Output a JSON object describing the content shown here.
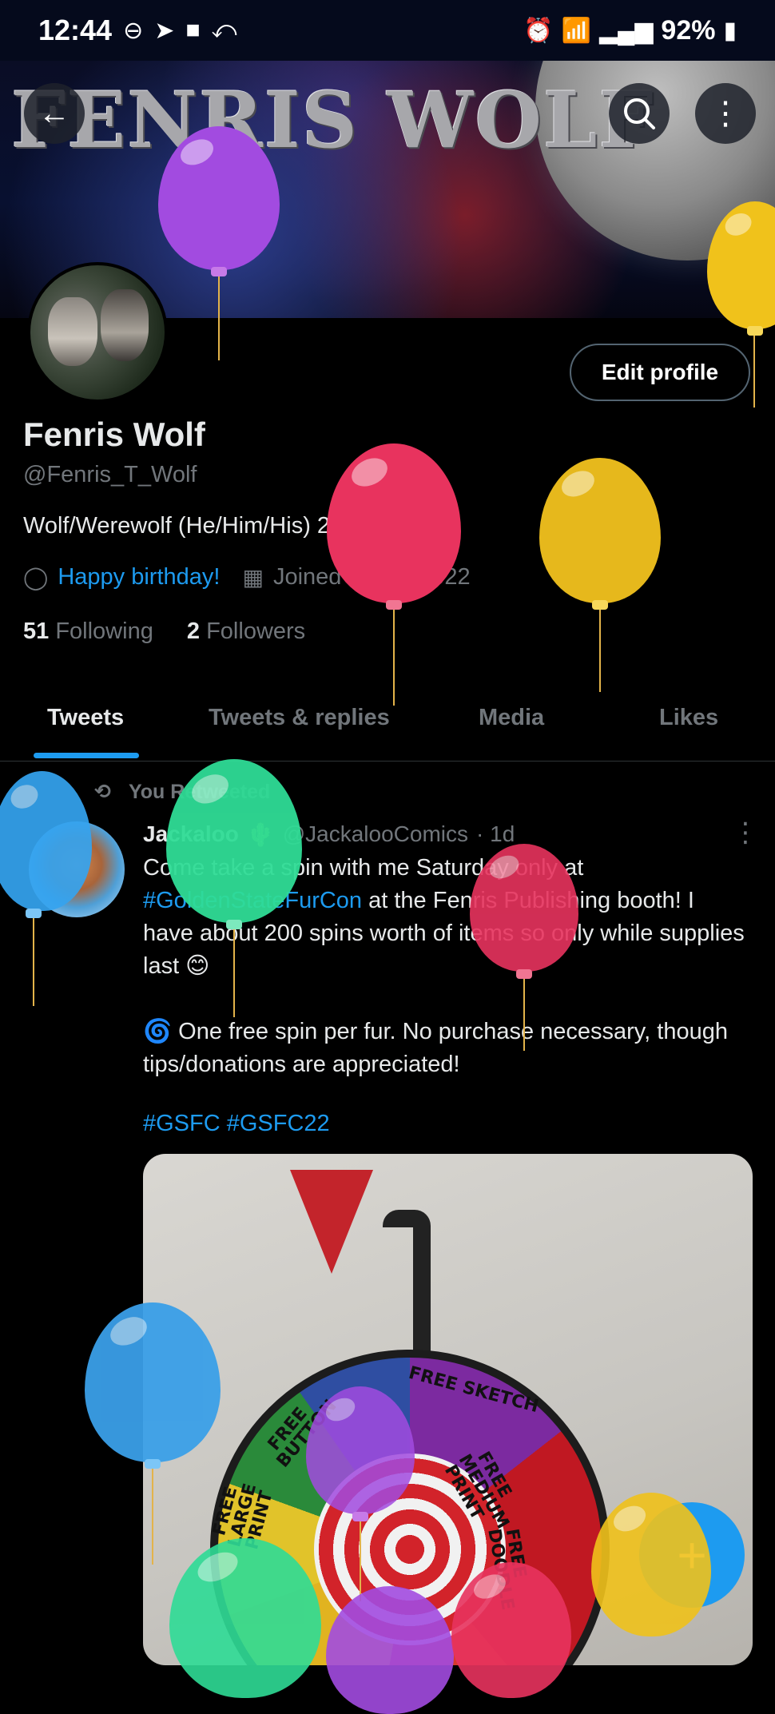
{
  "status_bar": {
    "time": "12:44",
    "left_icons": [
      "do-not-disturb-icon",
      "telegram-icon",
      "message-icon",
      "missed-call-icon"
    ],
    "right_icons": [
      "alarm-icon",
      "wifi-icon",
      "signal-icon"
    ],
    "battery": "92%"
  },
  "banner": {
    "title": "FENRIS WOLF"
  },
  "profile": {
    "edit_label": "Edit profile",
    "name": "Fenris Wolf",
    "handle": "@Fenris_T_Wolf",
    "bio": "Wolf/Werewolf (He/Him/His) 28",
    "birthday": "Happy birthday!",
    "joined": "Joined March 2022",
    "following_count": "51",
    "following_label": "Following",
    "followers_count": "2",
    "followers_label": "Followers"
  },
  "tabs": [
    {
      "label": "Tweets",
      "active": true
    },
    {
      "label": "Tweets & replies",
      "active": false
    },
    {
      "label": "Media",
      "active": false
    },
    {
      "label": "Likes",
      "active": false
    }
  ],
  "tweet": {
    "retweet_label": "You Retweeted",
    "author": "Jackaloo",
    "author_emoji": "🌵",
    "author_handle": "@JackalooComics",
    "time": "· 1d",
    "text_1": "Come take a spin with me Saturday only at",
    "text_link": "#GoldenStateFurCon",
    "text_2": " at the Fenris Publishing booth! I have about 200 spins worth of items so only while supplies last 😊",
    "text_3": "🌀 One free spin per fur. No purchase necessary, though tips/donations are appreciated!",
    "hashtags": "#GSFC #GSFC22",
    "wheel_labels": [
      "FREE SKETCH",
      "FREE MEDIUM PRINT",
      "FREE DOODLE",
      "FREE LARGE PRINT",
      "FREE BUTTON"
    ]
  },
  "fab_label": "+",
  "colors": {
    "accent": "#1d9bf0",
    "background": "#000000",
    "text_primary": "#e7e9ea",
    "text_secondary": "#71767b",
    "balloon_purple": "#a24be0",
    "balloon_red": "#e8335e",
    "balloon_yellow": "#f0c21b",
    "balloon_green": "#2fdc96",
    "balloon_blue": "#35a4f0"
  }
}
